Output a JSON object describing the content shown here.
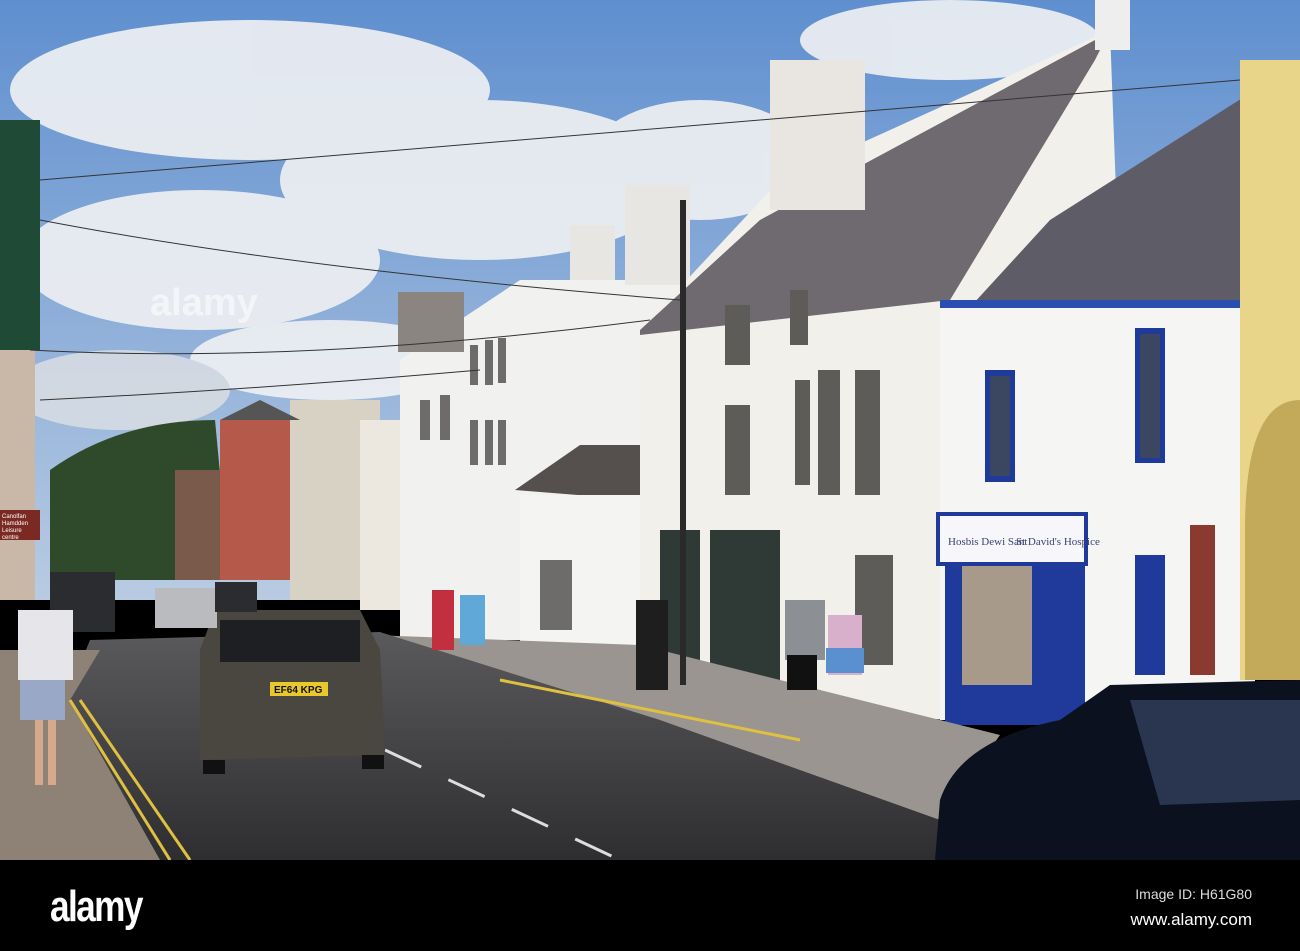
{
  "photo": {
    "watermark": "alamy",
    "shop_sign": {
      "welsh": "Hosbis Dewi Sant",
      "english": "St David's Hospice"
    },
    "road_sign": {
      "line1": "Canolfan",
      "line2": "Hamdden",
      "line3": "Leisure",
      "line4": "centre"
    },
    "number_plate": "EF64 KPG"
  },
  "footer": {
    "logo": "alamy",
    "image_id": "Image ID: H61G80",
    "website": "www.alamy.com"
  },
  "colors": {
    "sky": "#7fa6d6",
    "shopfront_blue": "#1f3a9a",
    "road": "#3f3f42"
  }
}
